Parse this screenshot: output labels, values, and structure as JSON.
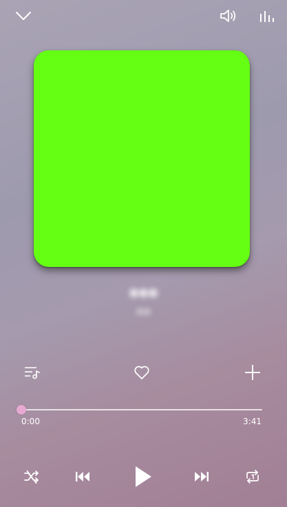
{
  "header": {
    "collapse_icon": "chevron-down-icon",
    "volume_icon": "speaker-icon",
    "equalizer_icon": "equalizer-icon"
  },
  "artwork": {
    "color": "#64ff13"
  },
  "track": {
    "title": "●●●",
    "artist": "●●"
  },
  "actions": {
    "queue_icon": "playlist-icon",
    "favorite_icon": "heart-icon",
    "add_icon": "plus-icon"
  },
  "progress": {
    "elapsed": "0:00",
    "total": "3:41",
    "fraction": 0.0
  },
  "controls": {
    "shuffle_icon": "shuffle-off-icon",
    "previous_icon": "skip-previous-icon",
    "play_icon": "play-icon",
    "next_icon": "skip-next-icon",
    "repeat_icon": "repeat-one-icon"
  },
  "colors": {
    "accent": "#e3a6cf",
    "artwork": "#64ff13"
  }
}
